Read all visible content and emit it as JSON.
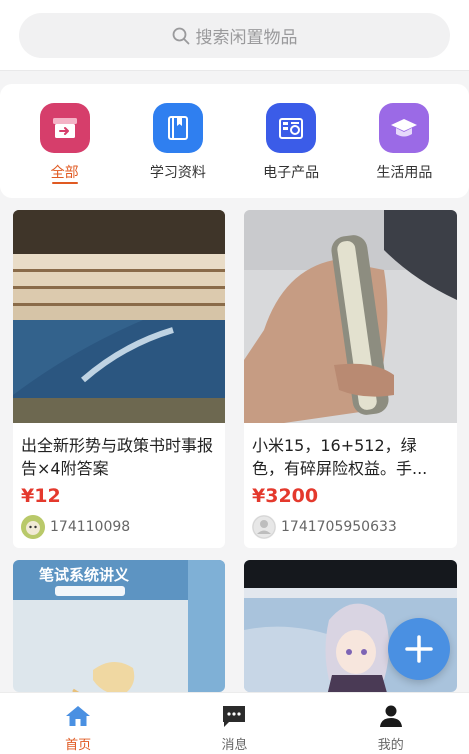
{
  "search": {
    "placeholder": "搜索闲置物品",
    "icon": "search-icon"
  },
  "categories": [
    {
      "label": "全部",
      "icon": "all-category-icon",
      "color": "#d63e6b",
      "active": true
    },
    {
      "label": "学习资料",
      "icon": "book-icon",
      "color": "#2f7ff0",
      "active": false
    },
    {
      "label": "电子产品",
      "icon": "electronics-icon",
      "color": "#3b5ce8",
      "active": false
    },
    {
      "label": "生活用品",
      "icon": "graduation-cap-icon",
      "color": "#9b6ae6",
      "active": false
    }
  ],
  "products": [
    {
      "title": "出全新形势与政策书时事报告×4附答案",
      "price": "¥12",
      "user": "174110098",
      "avatar": "photo-avatar"
    },
    {
      "title": "小米15，16+512，绿色，有碎屏险权益。手...",
      "price": "¥3200",
      "user": "1741705950633",
      "avatar": "default-avatar-icon"
    },
    {
      "cover_text": "笔试系统讲义"
    },
    {
      "cover_text": ""
    }
  ],
  "fab": {
    "icon": "plus-icon"
  },
  "tabbar": [
    {
      "label": "首页",
      "icon": "home-icon",
      "active": true
    },
    {
      "label": "消息",
      "icon": "message-icon",
      "active": false
    },
    {
      "label": "我的",
      "icon": "user-icon",
      "active": false
    }
  ],
  "colors": {
    "accent": "#e05a22",
    "price": "#e4392d",
    "fab": "#4a90e2",
    "nav_active_icon": "#4a90e2"
  }
}
